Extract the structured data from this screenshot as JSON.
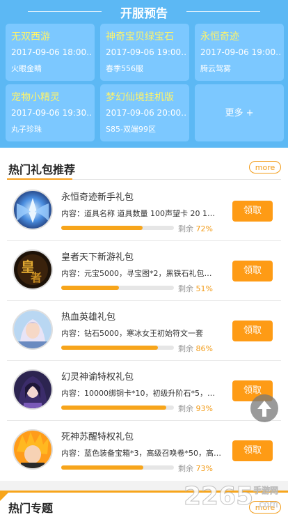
{
  "preview": {
    "title": "开服预告",
    "cards": [
      {
        "name": "无双西游",
        "time": "2017-09-06 18:00…",
        "server": "火眼金睛"
      },
      {
        "name": "神奇宝贝绿宝石",
        "time": "2017-09-06 19:00…",
        "server": "春季556服"
      },
      {
        "name": "永恒奇迹",
        "time": "2017-09-06 19:00…",
        "server": "腾云驾雾"
      },
      {
        "name": "宠物小精灵",
        "time": "2017-09-06 19:30…",
        "server": "丸子珍珠"
      },
      {
        "name": "梦幻仙境挂机版",
        "time": "2017-09-06 20:00…",
        "server": "S85-双端99区"
      }
    ],
    "more_label": "更多 +"
  },
  "gifts": {
    "title": "热门礼包推荐",
    "more": "more",
    "remain_label": "剩余",
    "claim_label": "领取",
    "items": [
      {
        "name": "永恒奇迹新手礼包",
        "desc": "内容：道具名称 道具数量 100声望卡 20 1…",
        "percent": "72%",
        "level": 0.72,
        "avatar": "angel-warrior-icon"
      },
      {
        "name": "皇者天下新游礼包",
        "desc": "内容：元宝5000，寻宝图*2，黑铁石礼包…",
        "percent": "51%",
        "level": 0.51,
        "avatar": "emperor-logo-icon"
      },
      {
        "name": "热血英雄礼包",
        "desc": "内容：钻石5000，寒冰女王初始符文一套",
        "percent": "86%",
        "level": 0.86,
        "avatar": "heroine-icon"
      },
      {
        "name": "幻灵神谕特权礼包",
        "desc": "内容：10000绑铜卡*10，初级升阶石*5，…",
        "percent": "93%",
        "level": 0.93,
        "avatar": "sorceress-icon"
      },
      {
        "name": "死神苏醒特权礼包",
        "desc": "内容：蓝色装备宝箱*3，高级召唤卷*50，高…",
        "percent": "73%",
        "level": 0.73,
        "avatar": "anime-hero-icon"
      }
    ]
  },
  "topics": {
    "title": "热门专题",
    "more": "more"
  },
  "watermark": {
    "text": "2265",
    "sub": "手游网",
    "url": ".com"
  },
  "colors": {
    "preview_bg": "#5cb8f4",
    "card_bg": "#7cc8ff",
    "card_name": "#fff46a",
    "accent": "#fe9b15"
  }
}
